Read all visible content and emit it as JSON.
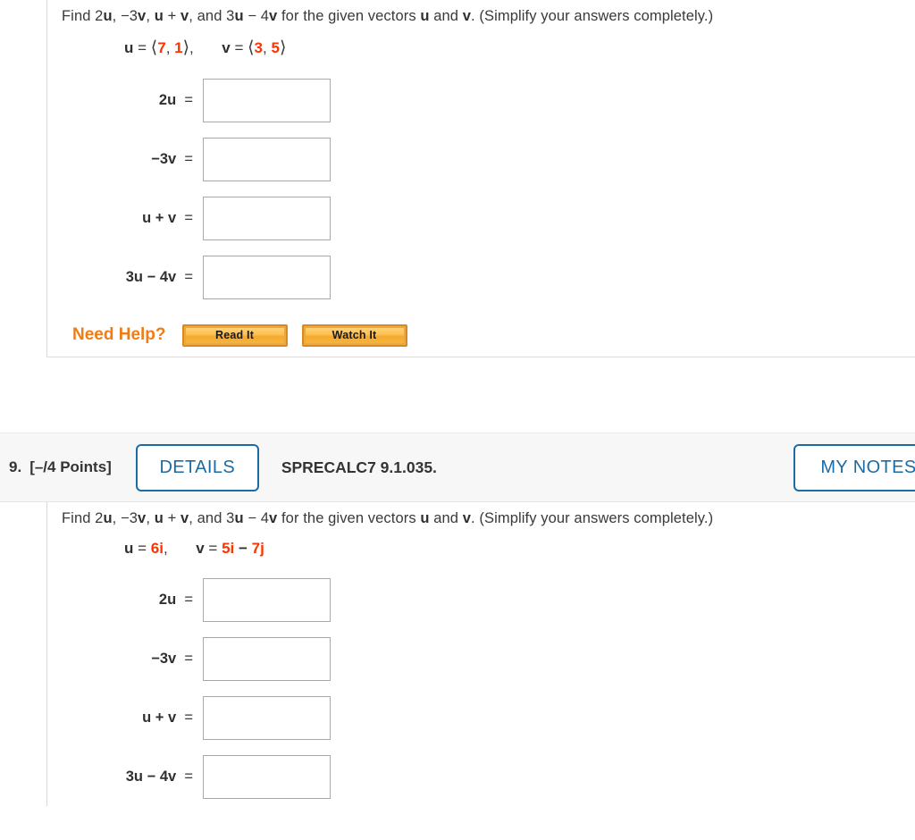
{
  "question_8": {
    "prompt": {
      "pre": "Find 2",
      "segments": [
        "Find 2",
        "u",
        ", −3",
        "v",
        ", ",
        "u",
        " + ",
        "v",
        ", and 3",
        "u",
        " − 4",
        "v",
        " for the given vectors ",
        "u",
        " and ",
        "v",
        ". (Simplify your answers completely.)"
      ],
      "full_text": "Find 2u, −3v, u + v, and 3u − 4v for the given vectors u and v. (Simplify your answers completely.)"
    },
    "vectors": {
      "u_label": "u",
      "u_eq": "=",
      "u_open": "⟨",
      "u_v1": "7",
      "u_comma": ",",
      "u_v2": "1",
      "u_close": "⟩",
      "u_trail": ",",
      "v_label": "v",
      "v_eq": "=",
      "v_open": "⟨",
      "v_v1": "3",
      "v_comma": ",",
      "v_v2": "5",
      "v_close": "⟩"
    },
    "answers": [
      {
        "coef": "2",
        "vec": "u",
        "eq": "=",
        "value": "",
        "placeholder": ""
      },
      {
        "coef": "−3",
        "vec": "v",
        "eq": "=",
        "value": "",
        "placeholder": ""
      },
      {
        "coef": "",
        "vec": "u + v",
        "eq": "=",
        "value": "",
        "placeholder": ""
      },
      {
        "coef": "3",
        "vec": "u − 4v",
        "eq": "=",
        "value": "",
        "placeholder": ""
      }
    ],
    "need_help": {
      "label": "Need Help?",
      "buttons": [
        "Read It",
        "Watch It"
      ]
    }
  },
  "question_9": {
    "header": {
      "number": "9.",
      "points": "[–/4 Points]",
      "details_label": "DETAILS",
      "code": "SPRECALC7 9.1.035.",
      "my_notes_label": "MY NOTES"
    },
    "prompt": {
      "full_text": "Find 2u, −3v, u + v, and 3u − 4v for the given vectors u and v. (Simplify your answers completely.)"
    },
    "vectors": {
      "u_label": "u",
      "u_eq": "=",
      "u_value": "6i",
      "u_trail": ",",
      "v_label": "v",
      "v_eq": "=",
      "v_value_1": "5i",
      "v_minus": "−",
      "v_value_2": "7j"
    },
    "answers": [
      {
        "label": "2u",
        "eq": "=",
        "value": "",
        "placeholder": ""
      },
      {
        "label": "−3v",
        "eq": "=",
        "value": "",
        "placeholder": ""
      },
      {
        "label": "u + v",
        "eq": "=",
        "value": "",
        "placeholder": ""
      },
      {
        "label": "3u − 4v",
        "eq": "=",
        "value": "",
        "placeholder": ""
      }
    ]
  },
  "colors": {
    "accent_red": "#ff3300",
    "link_blue": "#1b6ba4",
    "need_help_orange": "#f07c15",
    "button_orange": "#f0a93c"
  }
}
